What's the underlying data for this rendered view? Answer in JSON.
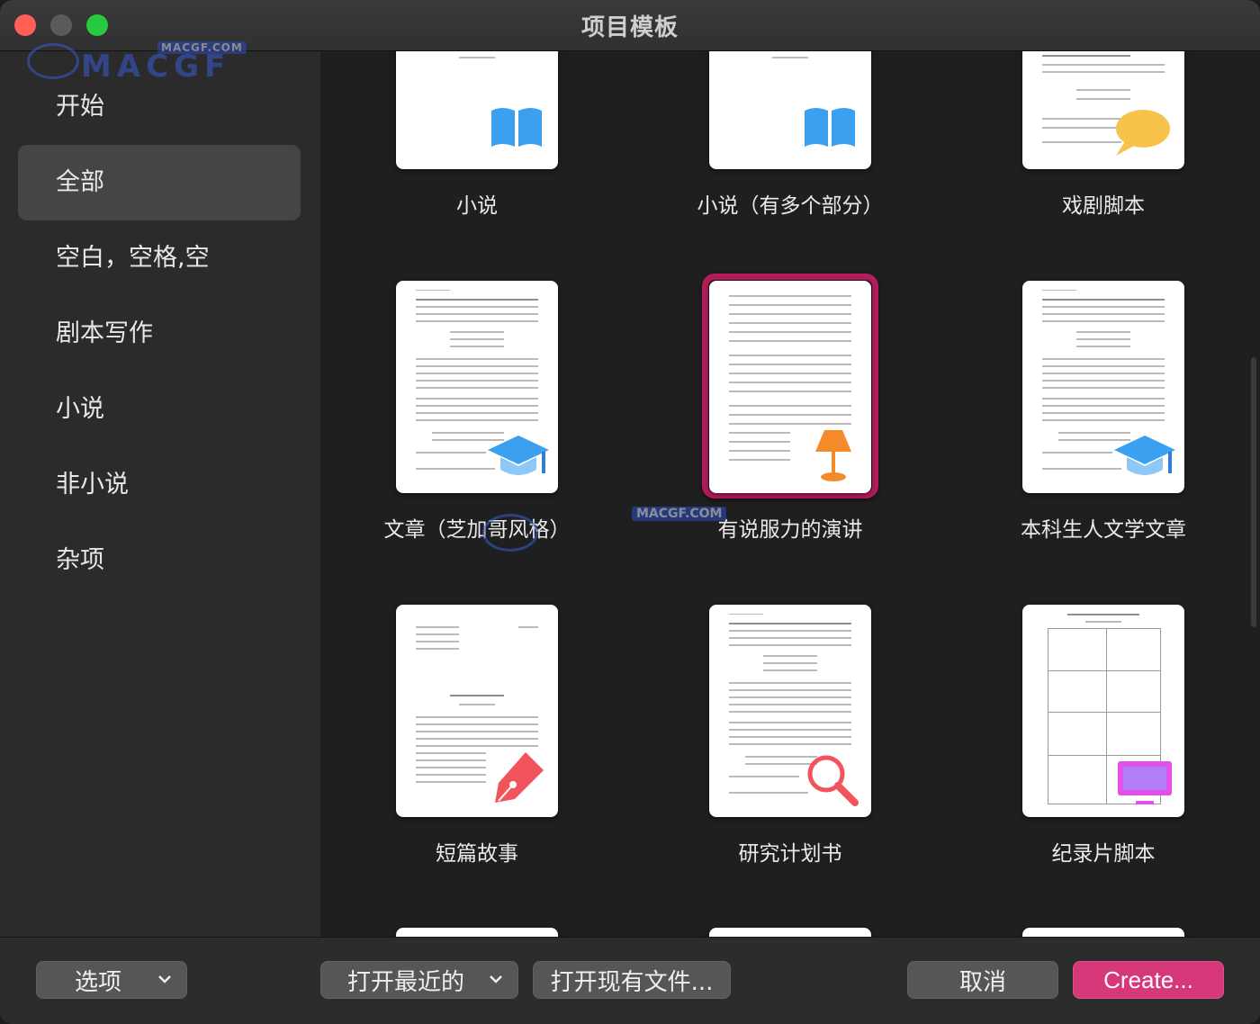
{
  "window": {
    "title": "项目模板"
  },
  "watermark": {
    "site": "MACGF.COM",
    "brand": "MACGF"
  },
  "sidebar": {
    "items": [
      {
        "label": "开始"
      },
      {
        "label": "全部",
        "selected": true
      },
      {
        "label": "空白，空格,空"
      },
      {
        "label": "剧本写作"
      },
      {
        "label": "小说"
      },
      {
        "label": "非小说"
      },
      {
        "label": "杂项"
      }
    ]
  },
  "templates": [
    {
      "label": "小说",
      "icon": "book-icon"
    },
    {
      "label": "小说（有多个部分）",
      "icon": "book-icon"
    },
    {
      "label": "戏剧脚本",
      "icon": "speech-bubble-icon"
    },
    {
      "label": "文章（芝加哥风格）",
      "icon": "graduation-cap-icon"
    },
    {
      "label": "有说服力的演讲",
      "icon": "podium-lamp-icon",
      "selected": true
    },
    {
      "label": "本科生人文学文章",
      "icon": "graduation-cap-icon"
    },
    {
      "label": "短篇故事",
      "icon": "fountain-pen-icon"
    },
    {
      "label": "研究计划书",
      "icon": "magnifier-icon"
    },
    {
      "label": "纪录片脚本",
      "icon": "monitor-icon"
    }
  ],
  "toolbar": {
    "options_label": "选项",
    "open_recent_label": "打开最近的",
    "open_existing_label": "打开现有文件...",
    "cancel_label": "取消",
    "create_label": "Create..."
  },
  "colors": {
    "accent": "#d63879",
    "selection_frame": "#b41c5c"
  }
}
